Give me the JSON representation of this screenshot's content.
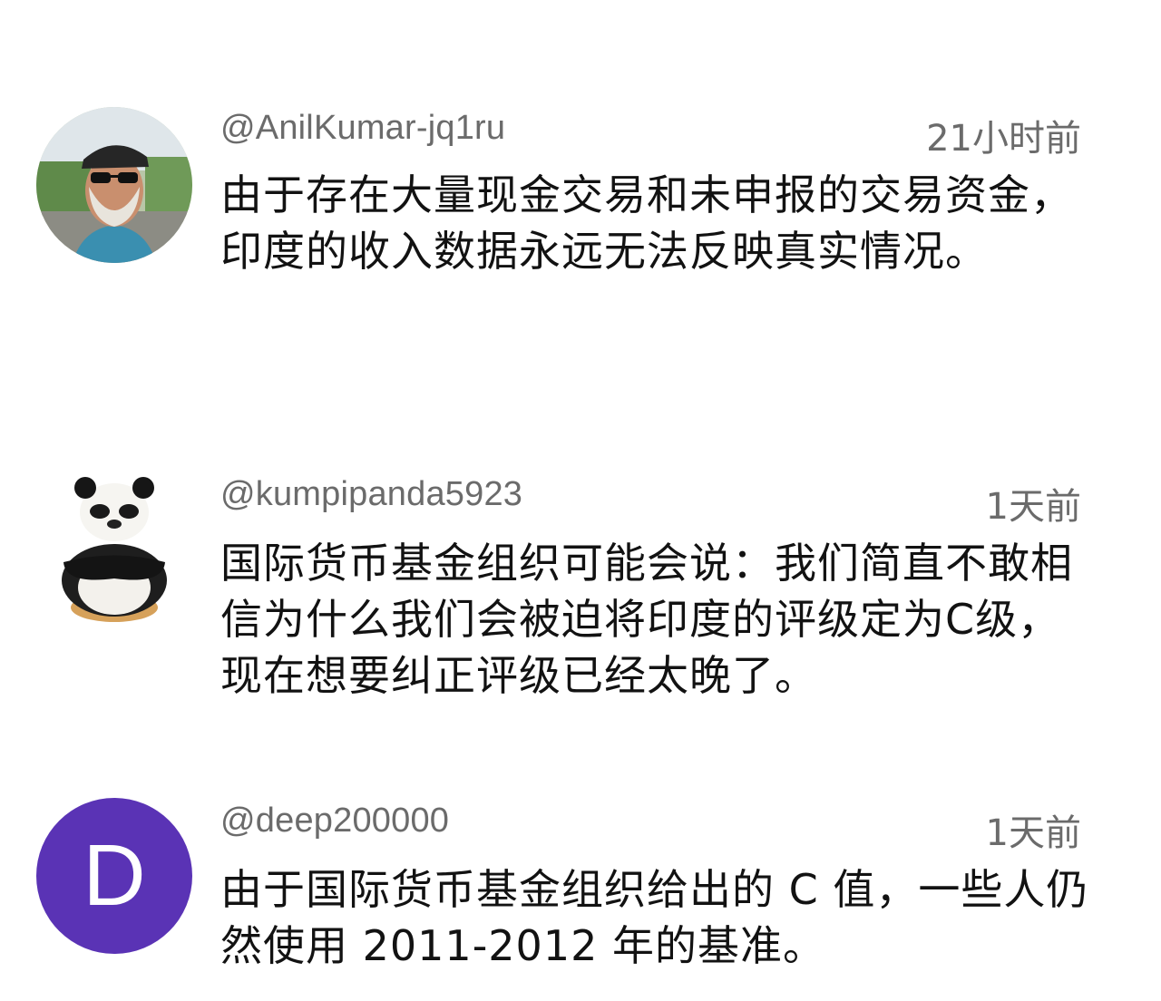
{
  "comments": [
    {
      "username": "@AnilKumar-jq1ru",
      "time": "21小时前",
      "text": "由于存在大量现金交易和未申报的交易资金，印度的收入数据永远无法反映真实情况。",
      "avatar": "photo-avatar"
    },
    {
      "username": "@kumpipanda5923",
      "time": "1天前",
      "text": "国际货币基金组织可能会说：我们简直不敢相信为什么我们会被迫将印度的评级定为C级，现在想要纠正评级已经太晚了。",
      "avatar": "panda-avatar"
    },
    {
      "username": "@deep200000",
      "time": "1天前",
      "text": "由于国际货币基金组织给出的 C 值，一些人仍然使用 2011-2012 年的基准。",
      "avatar_letter": "D",
      "avatar_color": "#5a33b5"
    }
  ]
}
